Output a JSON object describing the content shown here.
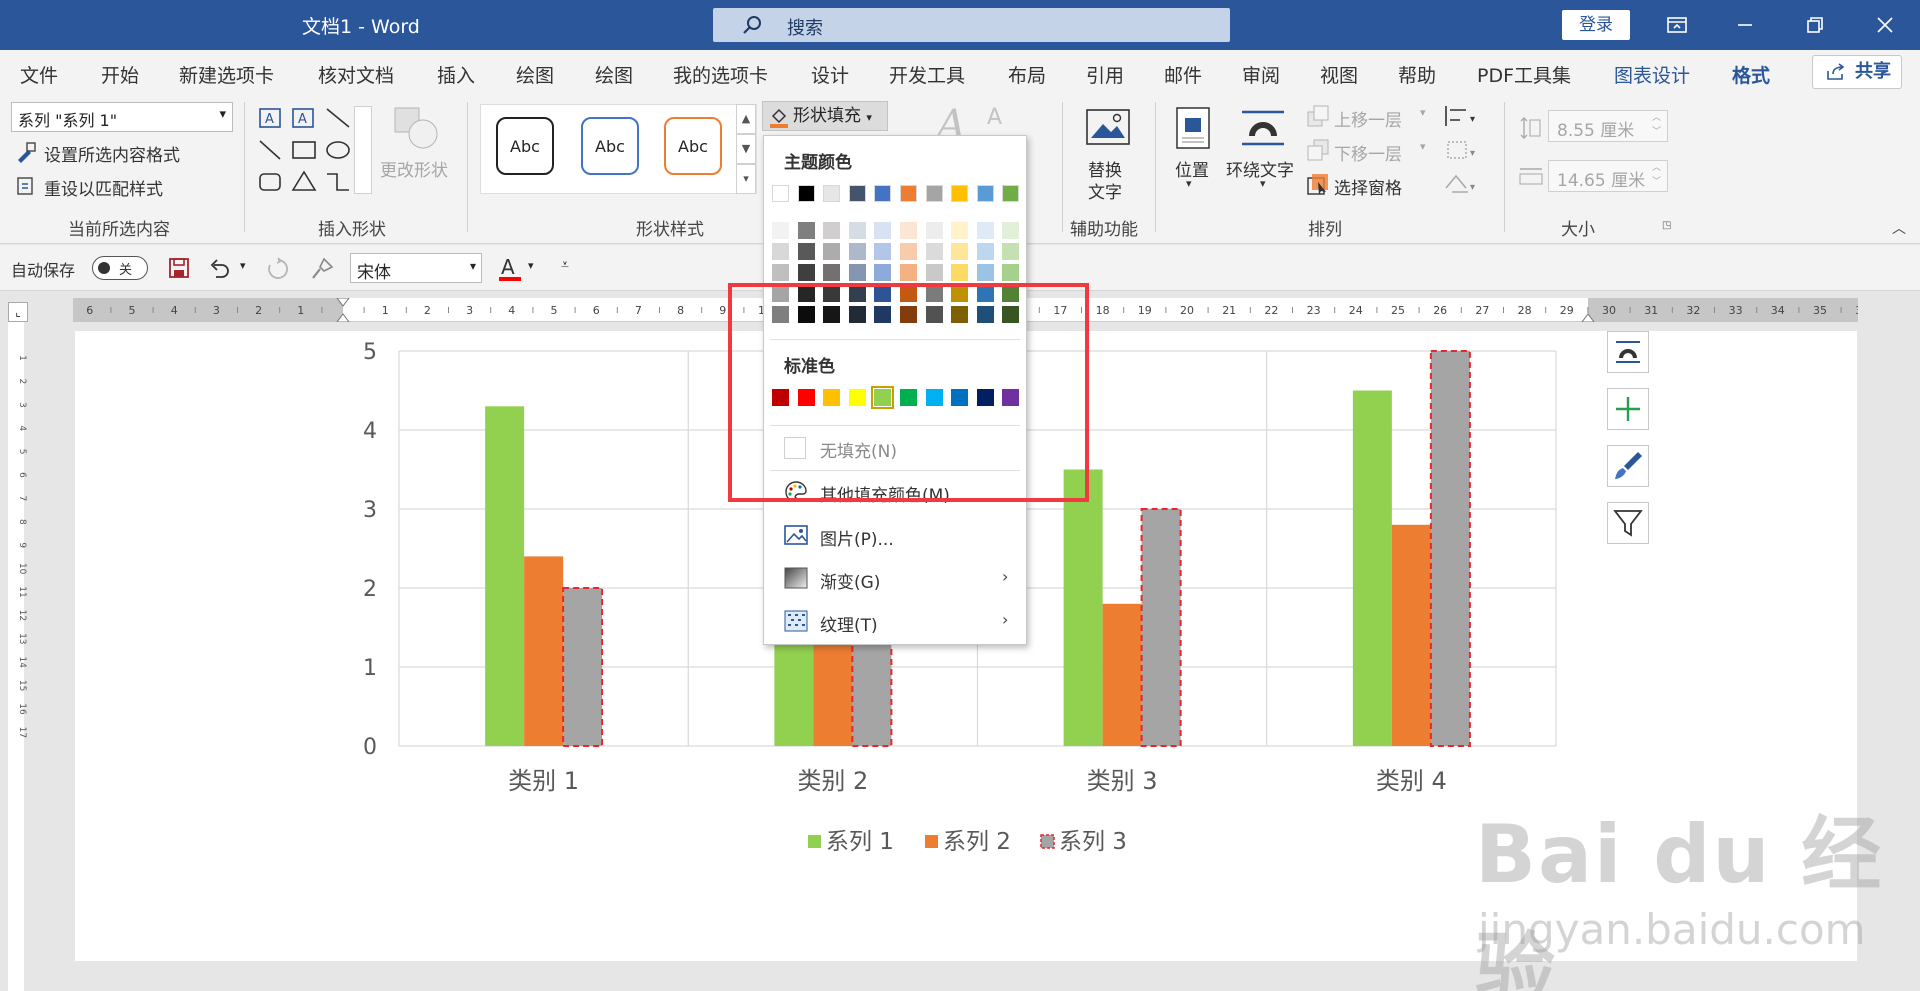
{
  "titlebar": {
    "doc_title": "文档1  -  Word",
    "search_placeholder": "搜索",
    "login": "登录"
  },
  "tabs": [
    "文件",
    "开始",
    "新建选项卡",
    "核对文档",
    "插入",
    "绘图",
    "绘图",
    "我的选项卡",
    "设计",
    "开发工具",
    "布局",
    "引用",
    "邮件",
    "审阅",
    "视图",
    "帮助",
    "PDF工具集",
    "图表设计",
    "格式"
  ],
  "share_label": "共享",
  "ribbon": {
    "selection_value": "系列 \"系列 1\"",
    "format_selection": "设置所选内容格式",
    "reset_style": "重设以匹配样式",
    "group_current": "当前所选内容",
    "change_shape": "更改形状",
    "group_insert_shape": "插入形状",
    "abc": "Abc",
    "group_shape_style": "形状样式",
    "shape_fill": "形状填充",
    "alt_text": "替换\n文字",
    "alt_text_1": "替换",
    "alt_text_2": "文字",
    "group_accessibility": "辅助功能",
    "position": "位置",
    "wrap_text": "环绕文字",
    "bring_forward": "上移一层",
    "send_backward": "下移一层",
    "selection_pane": "选择窗格",
    "group_arrange": "排列",
    "height": "8.55 厘米",
    "width": "14.65 厘米",
    "group_size": "大小"
  },
  "qat": {
    "autosave": "自动保存",
    "toggle": "关",
    "font": "宋体"
  },
  "ruler_numbers": [
    "6",
    "5",
    "4",
    "3",
    "2",
    "1",
    "",
    "1",
    "2",
    "3",
    "4",
    "5",
    "6",
    "7",
    "8",
    "9",
    "10",
    "11",
    "12",
    "13",
    "14",
    "15",
    "16",
    "17",
    "18",
    "19",
    "20",
    "21",
    "22",
    "23",
    "24",
    "25",
    "26",
    "27",
    "28",
    "29",
    "30",
    "31",
    "32",
    "33",
    "34",
    "35",
    "36"
  ],
  "vruler_numbers": [
    "1",
    "2",
    "3",
    "4",
    "5",
    "6",
    "7",
    "8",
    "9",
    "10",
    "11",
    "12",
    "13",
    "14",
    "15",
    "16",
    "17"
  ],
  "dropdown": {
    "theme_colors_header": "主题颜色",
    "standard_colors_header": "标准色",
    "no_fill": "无填充(N)",
    "more_colors": "其他填充颜色(M)...",
    "picture": "图片(P)...",
    "gradient": "渐变(G)",
    "texture": "纹理(T)",
    "theme_row": [
      "#ffffff",
      "#000000",
      "#e7e6e6",
      "#44546a",
      "#4472c4",
      "#ed7d31",
      "#a5a5a5",
      "#ffc000",
      "#5b9bd5",
      "#70ad47"
    ],
    "theme_shades": [
      [
        "#f2f2f2",
        "#7f7f7f",
        "#d0cece",
        "#d6dce4",
        "#d9e2f3",
        "#fbe5d5",
        "#ededed",
        "#fff2cc",
        "#deebf6",
        "#e2efd9"
      ],
      [
        "#d8d8d8",
        "#595959",
        "#aeabab",
        "#adb9ca",
        "#b4c6e7",
        "#f7cbac",
        "#dbdbdb",
        "#fee599",
        "#bdd7ee",
        "#c5e0b3"
      ],
      [
        "#bfbfbf",
        "#3f3f3f",
        "#757070",
        "#8496b0",
        "#8eaadb",
        "#f4b183",
        "#c9c9c9",
        "#ffd965",
        "#9cc3e5",
        "#a8d08d"
      ],
      [
        "#a5a5a5",
        "#262626",
        "#3a3838",
        "#323f4f",
        "#2f5496",
        "#c45911",
        "#7b7b7b",
        "#bf9000",
        "#2e75b5",
        "#538135"
      ],
      [
        "#7f7f7f",
        "#0c0c0c",
        "#171616",
        "#222a35",
        "#1f3864",
        "#833c0b",
        "#525252",
        "#7f6000",
        "#1f4e79",
        "#375623"
      ]
    ],
    "standard_row": [
      "#c00000",
      "#ff0000",
      "#ffc000",
      "#ffff00",
      "#92d050",
      "#00b050",
      "#00b0f0",
      "#0070c0",
      "#002060",
      "#7030a0"
    ]
  },
  "colors": {
    "accent": "#2b579a",
    "highlight": "#ee3a40",
    "series1": "#92d050",
    "series2": "#ed7d31",
    "series3": "#a5a5a5"
  },
  "chart_data": {
    "type": "bar",
    "categories": [
      "类别 1",
      "类别 2",
      "类别 3",
      "类别 4"
    ],
    "series": [
      {
        "name": "系列 1",
        "values": [
          4.3,
          2.5,
          3.5,
          4.5
        ]
      },
      {
        "name": "系列 2",
        "values": [
          2.4,
          4.4,
          1.8,
          2.8
        ]
      },
      {
        "name": "系列 3",
        "values": [
          2.0,
          2.0,
          3.0,
          5.0
        ]
      }
    ],
    "ylim": [
      0,
      5
    ],
    "yticks": [
      "0",
      "1",
      "2",
      "3",
      "4",
      "5"
    ],
    "grid": true,
    "legend": "bottom"
  },
  "watermark": "Bai du 经验",
  "watermark_url": "jingyan.baidu.com"
}
